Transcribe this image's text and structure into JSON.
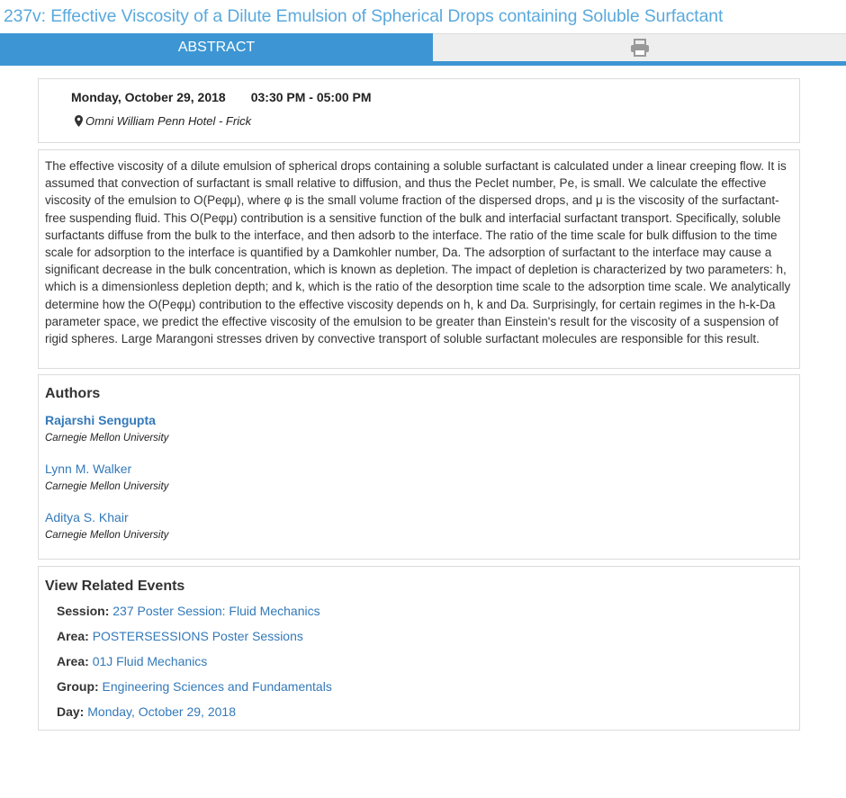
{
  "page": {
    "title": "237v: Effective Viscosity of a Dilute Emulsion of Spherical Drops containing Soluble Surfactant"
  },
  "tabs": {
    "abstract_label": "ABSTRACT",
    "print_icon": "printer-icon"
  },
  "session_info": {
    "date": "Monday, October 29, 2018",
    "time": "03:30 PM - 05:00 PM",
    "location": "Omni William Penn Hotel - Frick",
    "location_icon": "map-marker-icon"
  },
  "abstract": {
    "text": "The effective viscosity of a dilute emulsion of spherical drops containing a soluble surfactant is calculated under a linear creeping flow. It is assumed that convection of surfactant is small relative to diffusion, and thus the Peclet number, Pe, is small. We calculate the effective viscosity of the emulsion to O(Peφμ), where φ is the small volume fraction of the dispersed drops, and μ is the viscosity of the surfactant-free suspending fluid. This O(Peφμ) contribution is a sensitive function of the bulk and interfacial surfactant transport. Specifically, soluble surfactants diffuse from the bulk to the interface, and then adsorb to the interface. The ratio of the time scale for bulk diffusion to the time scale for adsorption to the interface is quantified by a Damkohler number, Da. The adsorption of surfactant to the interface may cause a significant decrease in the bulk concentration, which is known as depletion. The impact of depletion is characterized by two parameters: h, which is a dimensionless depletion depth; and k, which is the ratio of the desorption time scale to the adsorption time scale. We analytically determine how the O(Peφμ) contribution to the effective viscosity depends on h, k and Da. Surprisingly, for certain regimes in the h-k-Da parameter space, we predict the effective viscosity of the emulsion to be greater than Einstein's result for the viscosity of a suspension of rigid spheres. Large Marangoni stresses driven by convective transport of soluble surfactant molecules are responsible for this result."
  },
  "authors": {
    "heading": "Authors",
    "list": [
      {
        "name": "Rajarshi Sengupta",
        "affiliation": "Carnegie Mellon University"
      },
      {
        "name": "Lynn M. Walker",
        "affiliation": "Carnegie Mellon University"
      },
      {
        "name": "Aditya S. Khair",
        "affiliation": "Carnegie Mellon University"
      }
    ]
  },
  "related": {
    "heading": "View Related Events",
    "rows": [
      {
        "label": "Session:",
        "value": "237 Poster Session: Fluid Mechanics"
      },
      {
        "label": "Area:",
        "value": "POSTERSESSIONS Poster Sessions"
      },
      {
        "label": "Area:",
        "value": "01J Fluid Mechanics"
      },
      {
        "label": "Group:",
        "value": "Engineering Sciences and Fundamentals"
      },
      {
        "label": "Day:",
        "value": "Monday, October 29, 2018"
      }
    ]
  },
  "colors": {
    "title": "#5aa9dd",
    "tab_active": "#3d96d3",
    "link": "#3379b9"
  }
}
